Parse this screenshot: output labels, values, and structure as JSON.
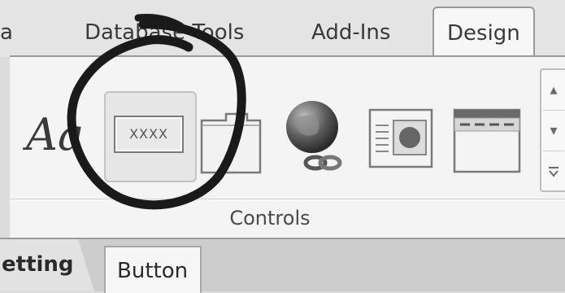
{
  "tabs": [
    {
      "label": "a"
    },
    {
      "label": "Database Tools"
    },
    {
      "label": "Add-Ins"
    },
    {
      "label": "Design",
      "active": true
    }
  ],
  "controls": {
    "group_label": "Controls",
    "items": [
      {
        "name": "label",
        "glyph": "Aa"
      },
      {
        "name": "button",
        "caption": "XXXX",
        "selected": true
      },
      {
        "name": "tab-control"
      },
      {
        "name": "hyperlink"
      },
      {
        "name": "web-browser-control"
      },
      {
        "name": "navigation-control"
      }
    ]
  },
  "bottom_tabs": [
    {
      "label": "etting"
    },
    {
      "label": "Button"
    }
  ],
  "icons": [
    "chevron-up-icon",
    "chevron-down-icon",
    "more-icon"
  ]
}
